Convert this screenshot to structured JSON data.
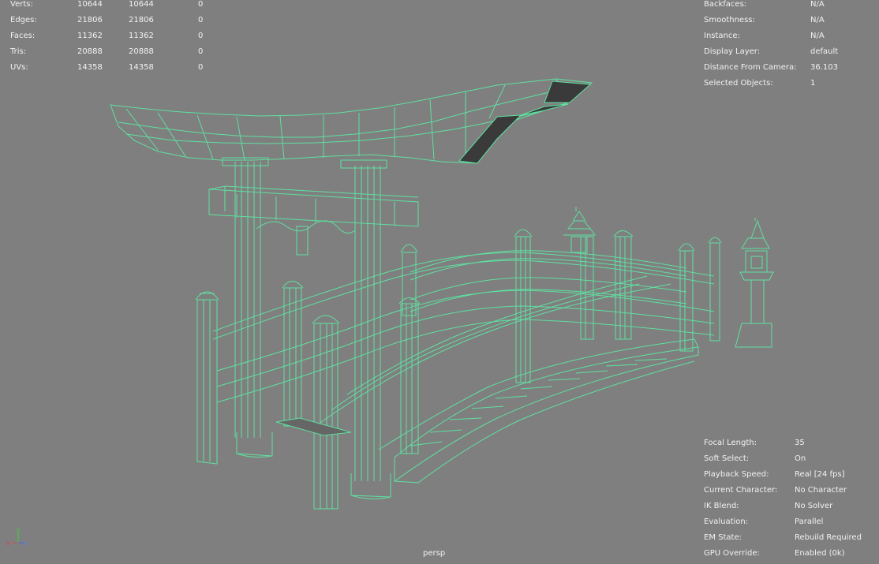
{
  "poly_stats": [
    {
      "label": "Verts:",
      "c1": "10644",
      "c2": "10644",
      "c3": "0"
    },
    {
      "label": "Edges:",
      "c1": "21806",
      "c2": "21806",
      "c3": "0"
    },
    {
      "label": "Faces:",
      "c1": "11362",
      "c2": "11362",
      "c3": "0"
    },
    {
      "label": "Tris:",
      "c1": "20888",
      "c2": "20888",
      "c3": "0"
    },
    {
      "label": "UVs:",
      "c1": "14358",
      "c2": "14358",
      "c3": "0"
    }
  ],
  "object_info": [
    {
      "label": "Backfaces:",
      "value": "N/A"
    },
    {
      "label": "Smoothness:",
      "value": "N/A"
    },
    {
      "label": "Instance:",
      "value": "N/A"
    },
    {
      "label": "Display Layer:",
      "value": "default"
    },
    {
      "label": "Distance From Camera:",
      "value": "36.103"
    },
    {
      "label": "Selected Objects:",
      "value": "1"
    }
  ],
  "scene_info": [
    {
      "label": "Focal Length:",
      "value": "35"
    },
    {
      "label": "Soft Select:",
      "value": "On"
    },
    {
      "label": "Playback Speed:",
      "value": "Real [24 fps]"
    },
    {
      "label": "Current Character:",
      "value": "No Character"
    },
    {
      "label": "IK Blend:",
      "value": "No Solver"
    },
    {
      "label": "Evaluation:",
      "value": "Parallel"
    },
    {
      "label": "EM State:",
      "value": "Rebuild Required"
    },
    {
      "label": "GPU Override:",
      "value": "Enabled (0k)"
    }
  ],
  "camera_label": "persp",
  "axis": {
    "x": "x",
    "y": "y",
    "z": "z"
  },
  "colors": {
    "background": "#7f7f7f",
    "wire": "#5fe0a0",
    "selected_face": "#3a3a3a"
  }
}
